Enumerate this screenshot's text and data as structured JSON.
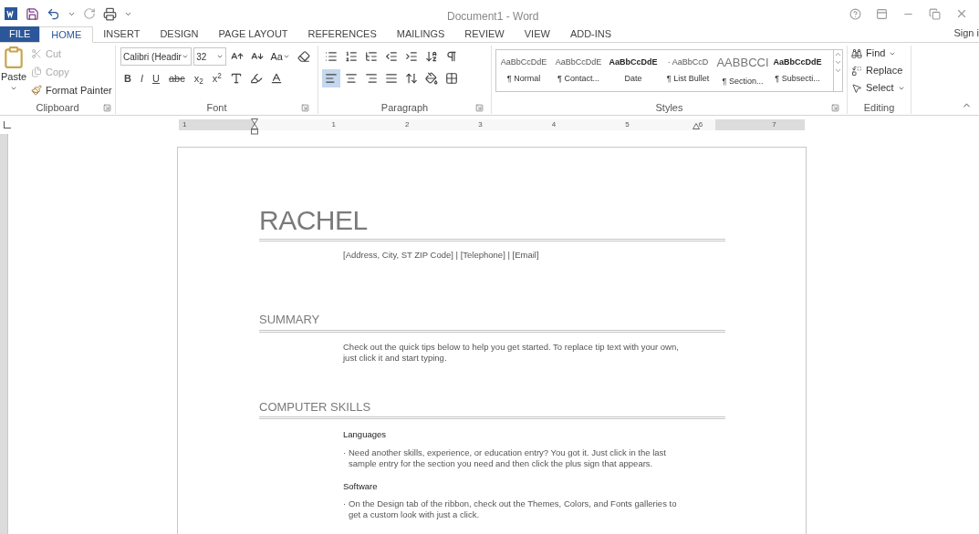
{
  "window": {
    "title": "Document1 - Word"
  },
  "tabs": [
    {
      "label": "FILE",
      "kind": "file",
      "selected": false
    },
    {
      "label": "HOME",
      "kind": "tab",
      "selected": true
    },
    {
      "label": "INSERT",
      "kind": "tab",
      "selected": false
    },
    {
      "label": "DESIGN",
      "kind": "tab",
      "selected": false
    },
    {
      "label": "PAGE LAYOUT",
      "kind": "tab",
      "selected": false
    },
    {
      "label": "REFERENCES",
      "kind": "tab",
      "selected": false
    },
    {
      "label": "MAILINGS",
      "kind": "tab",
      "selected": false
    },
    {
      "label": "REVIEW",
      "kind": "tab",
      "selected": false
    },
    {
      "label": "VIEW",
      "kind": "tab",
      "selected": false
    },
    {
      "label": "ADD-INS",
      "kind": "tab",
      "selected": false
    }
  ],
  "sign_in": "Sign i",
  "clipboard": {
    "label": "Clipboard",
    "paste": "Paste",
    "items": [
      {
        "label": "Cut",
        "disabled": true
      },
      {
        "label": "Copy",
        "disabled": true
      },
      {
        "label": "Format Painter",
        "disabled": false
      }
    ]
  },
  "font": {
    "label": "Font",
    "font_name": "Calibri (Headir",
    "font_size": "32",
    "change_case": "Aa",
    "format_buttons": [
      "B",
      "I",
      "U",
      "abc",
      "x$_{2}$",
      "x$^{2}$"
    ]
  },
  "paragraph": {
    "label": "Paragraph",
    "alignments": [
      {
        "selected": true
      },
      {
        "selected": false
      },
      {
        "selected": false
      },
      {
        "selected": false
      }
    ]
  },
  "styles": {
    "label": "Styles",
    "items": [
      {
        "preview": "AaBbCcDdE",
        "name": "¶ Normal",
        "kind": "plain"
      },
      {
        "preview": "AaBbCcDdE",
        "name": "¶ Contact...",
        "kind": "plain"
      },
      {
        "preview": "AaBbCcDdE",
        "name": "Date",
        "kind": "bold"
      },
      {
        "preview": "· AaBbCcD",
        "name": "¶ List Bullet",
        "kind": "plain"
      },
      {
        "preview": "AABBCCI",
        "name": "¶ Section...",
        "kind": "large"
      },
      {
        "preview": "AaBbCcDdE",
        "name": "¶ Subsecti...",
        "kind": "bold"
      }
    ]
  },
  "editing": {
    "label": "Editing",
    "items": [
      "Find",
      "Replace",
      "Select"
    ]
  },
  "ruler": {
    "labels": [
      "1",
      "1",
      "2",
      "3",
      "4",
      "5",
      "6",
      "7"
    ]
  },
  "document": {
    "name": "RACHEL",
    "contact": "[Address, City, ST  ZIP Code] | [Telephone] | [Email]",
    "sections": [
      {
        "heading": "SUMMARY",
        "body": [
          {
            "kind": "paragraph",
            "text": "Check out the quick tips below to help you get started. To replace tip text with your own, just click it and start typing."
          }
        ]
      },
      {
        "heading": "COMPUTER SKILLS",
        "body": [
          {
            "kind": "subheading",
            "text": "Languages"
          },
          {
            "kind": "bullet",
            "marker": "·",
            "text": "Need another skills, experience, or education entry? You got it. Just click in the last sample entry for the section you need and then click the plus sign that appears."
          },
          {
            "kind": "subheading",
            "text": "Software"
          },
          {
            "kind": "bullet",
            "marker": "·",
            "text": "On the Design tab of the ribbon, check out the Themes, Colors, and Fonts galleries to get a custom look with just a click."
          }
        ]
      }
    ]
  }
}
